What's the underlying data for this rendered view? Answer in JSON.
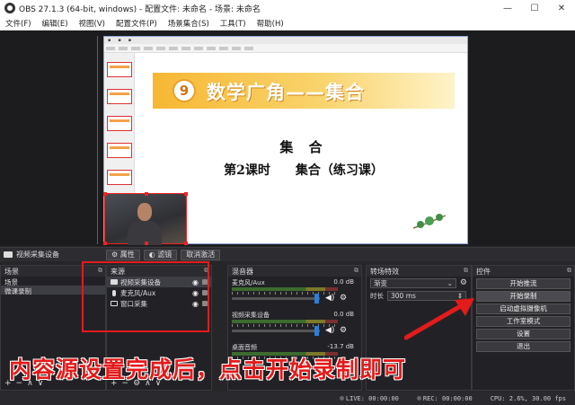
{
  "window": {
    "title": "OBS 27.1.3 (64-bit, windows) - 配置文件: 未命名 - 场景: 未命名",
    "controls": [
      "—",
      "☐",
      "✕"
    ]
  },
  "menubar": [
    "文件(F)",
    "编辑(E)",
    "视图(V)",
    "配置文件(P)",
    "场景集合(S)",
    "工具(T)",
    "帮助(H)"
  ],
  "preview": {
    "slide_number": "9",
    "slide_banner": "数学广角——集合",
    "slide_heading": "集 合",
    "slide_subheading": "第2课时　　集合（练习课）"
  },
  "source_toolbar": {
    "selected_source": "视频采集设备",
    "properties": "属性",
    "filters": "滤镜",
    "deactivate": "取消激活"
  },
  "scenes": {
    "title": "场景",
    "items": [
      "场景",
      "微课录制"
    ]
  },
  "sources": {
    "title": "来源",
    "items": [
      {
        "label": "视频采集设备"
      },
      {
        "label": "麦克风/Aux"
      },
      {
        "label": "窗口采集"
      }
    ]
  },
  "mixer": {
    "title": "混音器",
    "channels": [
      {
        "name": "麦克风/Aux",
        "db": "0.0 dB"
      },
      {
        "name": "视频采集设备",
        "db": "0.0 dB"
      },
      {
        "name": "桌面音频",
        "db": "-13.7 dB"
      }
    ]
  },
  "transitions": {
    "title": "转场特效",
    "selected": "渐变",
    "duration_label": "时长",
    "duration_value": "300 ms"
  },
  "controls": {
    "title": "控件",
    "buttons": [
      "开始推流",
      "开始录制",
      "启动虚拟摄像机",
      "工作室模式",
      "设置",
      "退出"
    ]
  },
  "status": {
    "live": "LIVE: 00:00:00",
    "rec": "REC: 00:00:00",
    "cpu": "CPU: 2.6%, 30.00 fps"
  },
  "annotation": {
    "caption": "内容源设置完成后，点击开始录制即可"
  },
  "colors": {
    "highlight": "#e31b1b",
    "accent": "#2d7fd6",
    "panel": "#222226"
  }
}
